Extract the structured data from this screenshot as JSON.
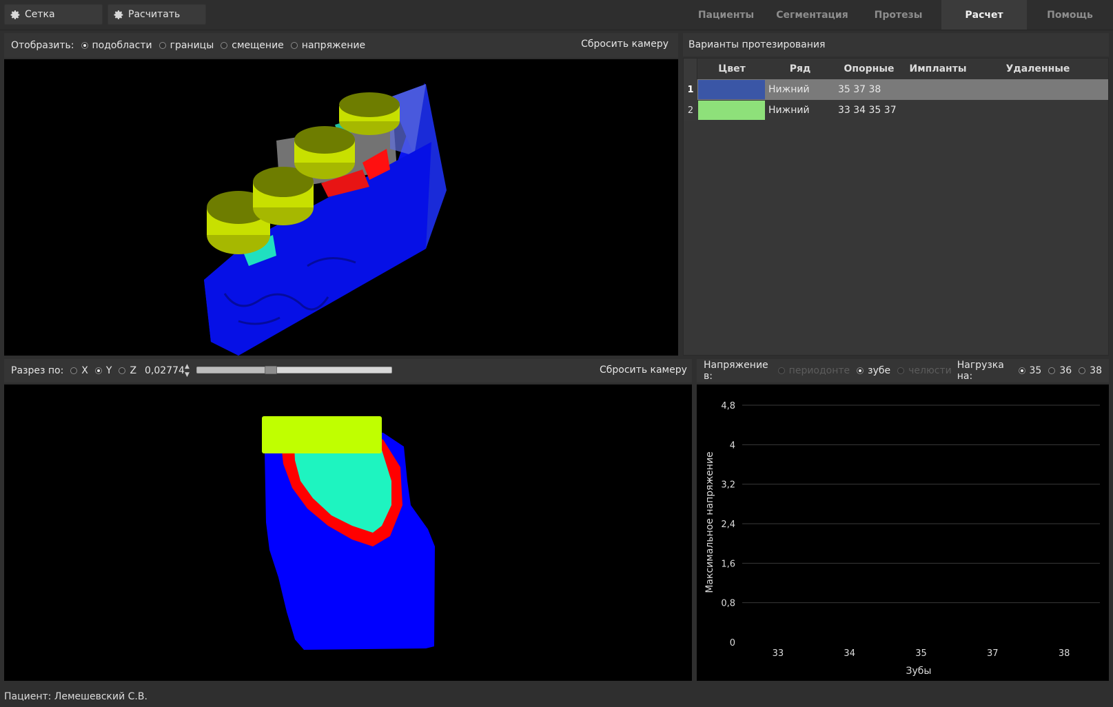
{
  "toolbar": {
    "mesh_label": "Сетка",
    "calc_label": "Расчитать"
  },
  "tabs": [
    {
      "label": "Пациенты",
      "active": false
    },
    {
      "label": "Сегментация",
      "active": false
    },
    {
      "label": "Протезы",
      "active": false
    },
    {
      "label": "Расчет",
      "active": true
    },
    {
      "label": "Помощь",
      "active": false
    }
  ],
  "view3d": {
    "display_label": "Отобразить:",
    "options": [
      {
        "label": "подобласти",
        "checked": true
      },
      {
        "label": "границы",
        "checked": false
      },
      {
        "label": "смещение",
        "checked": false
      },
      {
        "label": "напряжение",
        "checked": false
      }
    ],
    "reset_camera": "Сбросить камеру"
  },
  "variants": {
    "title": "Варианты протезирования",
    "columns": [
      "Цвет",
      "Ряд",
      "Опорные",
      "Импланты",
      "Удаленные"
    ],
    "rows": [
      {
        "num": "1",
        "color": "#3a56a6",
        "row": "Нижний",
        "support": "35 37 38",
        "implants": "",
        "removed": "",
        "selected": true
      },
      {
        "num": "2",
        "color": "#8ee07a",
        "row": "Нижний",
        "support": "33 34 35 37",
        "implants": "",
        "removed": "",
        "selected": false
      }
    ]
  },
  "section": {
    "label": "Разрез по:",
    "axes": [
      {
        "label": "X",
        "checked": false
      },
      {
        "label": "Y",
        "checked": true
      },
      {
        "label": "Z",
        "checked": false
      }
    ],
    "value": "0,02774",
    "slider_position": 0.37,
    "reset_camera": "Сбросить камеру"
  },
  "stress": {
    "label": "Напряжение в:",
    "options": [
      {
        "label": "периодонте",
        "checked": false,
        "disabled": true
      },
      {
        "label": "зубе",
        "checked": true,
        "disabled": false
      },
      {
        "label": "челюсти",
        "checked": false,
        "disabled": true
      }
    ],
    "load_label": "Нагрузка на:",
    "load_options": [
      {
        "label": "35",
        "checked": true
      },
      {
        "label": "36",
        "checked": false
      },
      {
        "label": "38",
        "checked": false
      }
    ]
  },
  "chart_data": {
    "type": "bar",
    "categories": [
      "33",
      "34",
      "35",
      "37",
      "38"
    ],
    "values": [
      0,
      0,
      0,
      0,
      0
    ],
    "y_ticks": [
      "0",
      "0,8",
      "1,6",
      "2,4",
      "3,2",
      "4",
      "4,8"
    ],
    "ylim": [
      0,
      4.8
    ],
    "xlabel": "Зубы",
    "ylabel": "Максимальное напряжение",
    "grid": true,
    "legend": "none"
  },
  "status": {
    "patient": "Пациент: Лемешевский С.В."
  },
  "icons": {
    "gear": "gear-icon"
  }
}
